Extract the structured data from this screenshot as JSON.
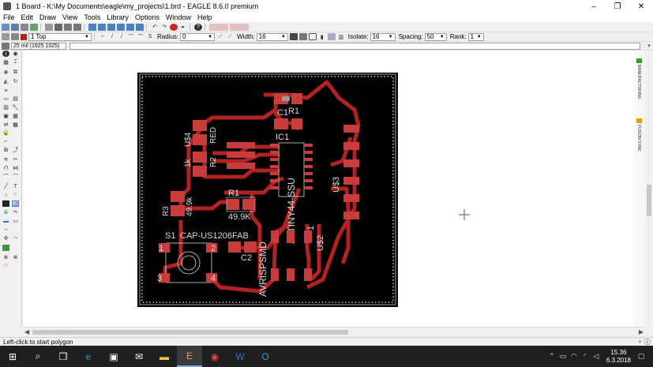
{
  "window": {
    "title": "1 Board - K:\\My Documents\\eagle\\my_projects\\1.brd - EAGLE 8.6.0 premium",
    "minimize": "–",
    "maximize": "❐",
    "close": "✕"
  },
  "menu": [
    "File",
    "Edit",
    "Draw",
    "View",
    "Tools",
    "Library",
    "Options",
    "Window",
    "Help"
  ],
  "parambar": {
    "layer": "1 Top",
    "radius_label": "Radius:",
    "radius_value": "0",
    "width_label": "Width:",
    "width_value": "16",
    "isolate_label": "Isolate:",
    "isolate_value": "16",
    "spacing_label": "Spacing:",
    "spacing_value": "50",
    "rank_label": "Rank:",
    "rank_value": "1"
  },
  "coords": "25 mil (1925 1025)",
  "status_message": "Left-click to start polygon",
  "right_tabs": {
    "manufacturing": "MANUFACTURING",
    "fusion_sync": "FUSION SYNC"
  },
  "board_labels": {
    "c1": "C1",
    "r1_top": "R1",
    "ic1": "IC1",
    "us4": "U$4",
    "red": "RED",
    "r2": "R2",
    "r2_value": "1k",
    "r3": "R3",
    "r3_value": "49.9k",
    "r1": "R1",
    "r1_value": "49.9K",
    "s1": "S1",
    "s1_value": "CAP-US1206FAB",
    "c2": "C2",
    "attiny": "ATTINY44-SSU",
    "us3": "U$3",
    "us2": "U$2",
    "avrisp": "AVRISPSMD",
    "pin1": "1",
    "pin2": "2",
    "pin3": "3",
    "pin4": "4",
    "ic_pin1": "1"
  },
  "clock": {
    "time": "15.36",
    "date": "6.3.2018"
  },
  "colors": {
    "board_bg": "#000000",
    "copper": "#b22222",
    "pads": "#c83c3c",
    "silk": "#d9d9d9",
    "outline": "#e8c8a8"
  }
}
